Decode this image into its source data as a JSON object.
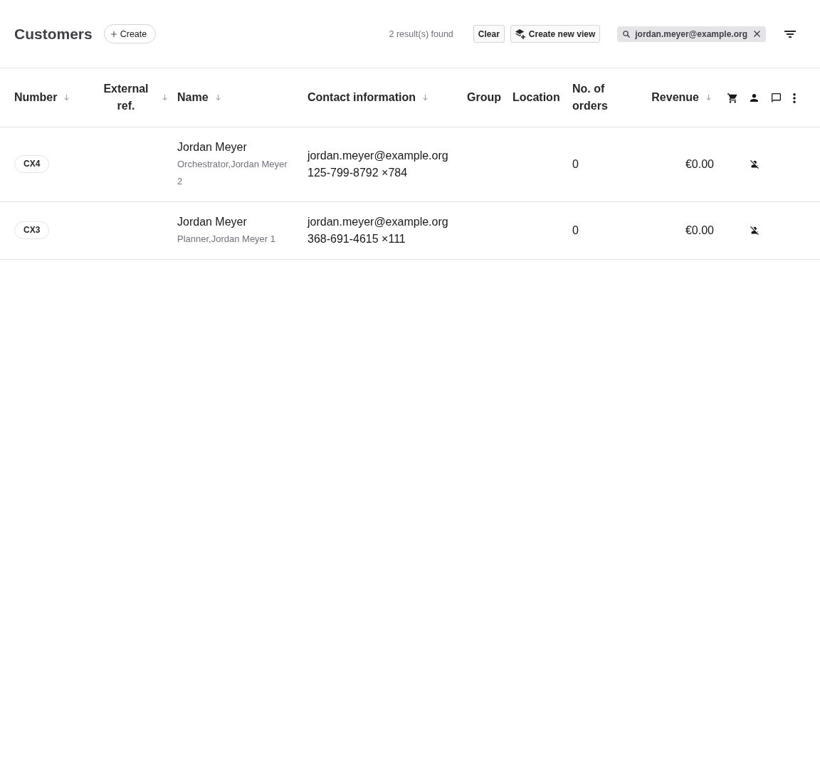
{
  "page": {
    "title": "Customers",
    "create_button": "Create"
  },
  "toolbar": {
    "result_count": "2 result(s) found",
    "clear_button": "Clear",
    "create_view_button": "Create new view",
    "filter_chip": {
      "label": "jordan.meyer@example.org"
    }
  },
  "table": {
    "columns": [
      {
        "label": "Number",
        "kind": "text",
        "sortable": true
      },
      {
        "label": "External ref.",
        "kind": "text",
        "sortable": true
      },
      {
        "label": "Name",
        "kind": "text",
        "sortable": true
      },
      {
        "label": "Contact information",
        "kind": "text",
        "sortable": true
      },
      {
        "label": "Group",
        "kind": "text",
        "sortable": false
      },
      {
        "label": "Location",
        "kind": "text",
        "sortable": false
      },
      {
        "label": "No. of orders",
        "kind": "text",
        "sortable": false
      },
      {
        "label": "Revenue",
        "kind": "amount",
        "sortable": true
      }
    ],
    "rows": [
      {
        "number": "CX4",
        "name": "Jordan Meyer",
        "role": "Orchestrator,Jordan Meyer 2",
        "email": "jordan.meyer@example.org",
        "phone": "125-799-8792 ×784",
        "orders": "0",
        "revenue": "€0.00",
        "has_user": false
      },
      {
        "number": "CX3",
        "name": "Jordan Meyer",
        "role": "Planner,Jordan Meyer 1",
        "email": "jordan.meyer@example.org",
        "phone": "368-691-4615 ×111",
        "orders": "0",
        "revenue": "€0.00",
        "has_user": false
      }
    ]
  }
}
